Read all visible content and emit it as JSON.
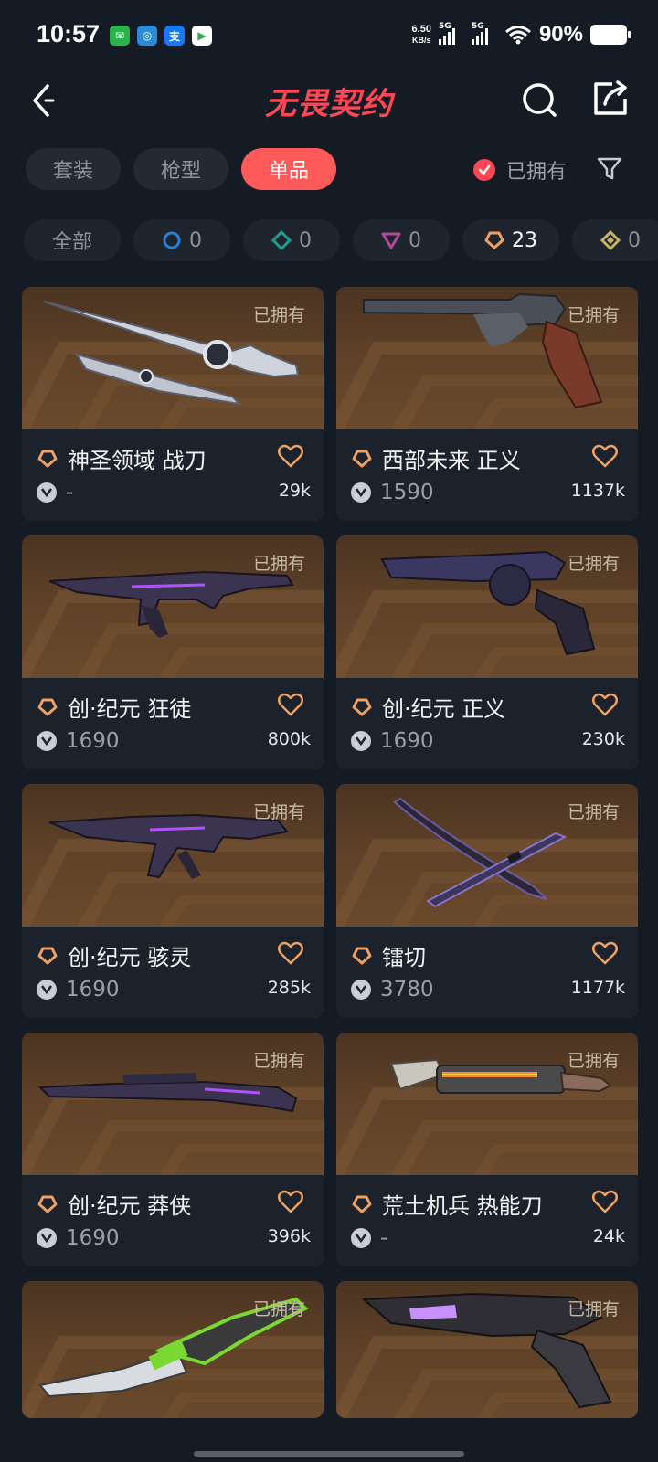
{
  "status_bar": {
    "time": "10:57",
    "net_speed_value": "6.50",
    "net_speed_unit": "KB/s",
    "signal1": "5G",
    "signal2": "5G",
    "battery": "90%"
  },
  "header": {
    "title": "无畏契约"
  },
  "tabs": [
    {
      "label": "套装",
      "active": false
    },
    {
      "label": "枪型",
      "active": false
    },
    {
      "label": "单品",
      "active": true
    }
  ],
  "owned_filter": {
    "label": "已拥有",
    "checked": true
  },
  "tiers": [
    {
      "label": "全部"
    },
    {
      "count": "0",
      "icon": "select-tier-icon",
      "color": "#2a7fd0"
    },
    {
      "count": "0",
      "icon": "deluxe-tier-icon",
      "color": "#1f9e8e"
    },
    {
      "count": "0",
      "icon": "premium-tier-icon",
      "color": "#b04a9a"
    },
    {
      "count": "23",
      "icon": "exclusive-tier-icon",
      "color": "#f0a060"
    },
    {
      "count": "0",
      "icon": "ultra-tier-icon",
      "color": "#c8b460"
    }
  ],
  "items": [
    {
      "owned": "已拥有",
      "name": "神圣领域 战刀",
      "price": "-",
      "likes": "29k",
      "weapon": "sword"
    },
    {
      "owned": "已拥有",
      "name": "西部未来 正义",
      "price": "1590",
      "likes": "1137k",
      "weapon": "revolver"
    },
    {
      "owned": "已拥有",
      "name": "创·纪元 狂徒",
      "price": "1690",
      "likes": "800k",
      "weapon": "rifle"
    },
    {
      "owned": "已拥有",
      "name": "创·纪元 正义",
      "price": "1690",
      "likes": "230k",
      "weapon": "revolver2"
    },
    {
      "owned": "已拥有",
      "name": "创·纪元 骇灵",
      "price": "1690",
      "likes": "285k",
      "weapon": "smg"
    },
    {
      "owned": "已拥有",
      "name": "镭切",
      "price": "3780",
      "likes": "1177k",
      "weapon": "katana"
    },
    {
      "owned": "已拥有",
      "name": "创·纪元 莽侠",
      "price": "1690",
      "likes": "396k",
      "weapon": "shotgun"
    },
    {
      "owned": "已拥有",
      "name": "荒土机兵 热能刀",
      "price": "-",
      "likes": "24k",
      "weapon": "heatknife"
    },
    {
      "owned": "已拥有",
      "weapon": "greenknife"
    },
    {
      "owned": "已拥有",
      "weapon": "pistol"
    }
  ],
  "colors": {
    "accent": "#ff4655",
    "background": "#151b24",
    "card": "#1c222b",
    "tier_exclusive": "#f0a060"
  }
}
